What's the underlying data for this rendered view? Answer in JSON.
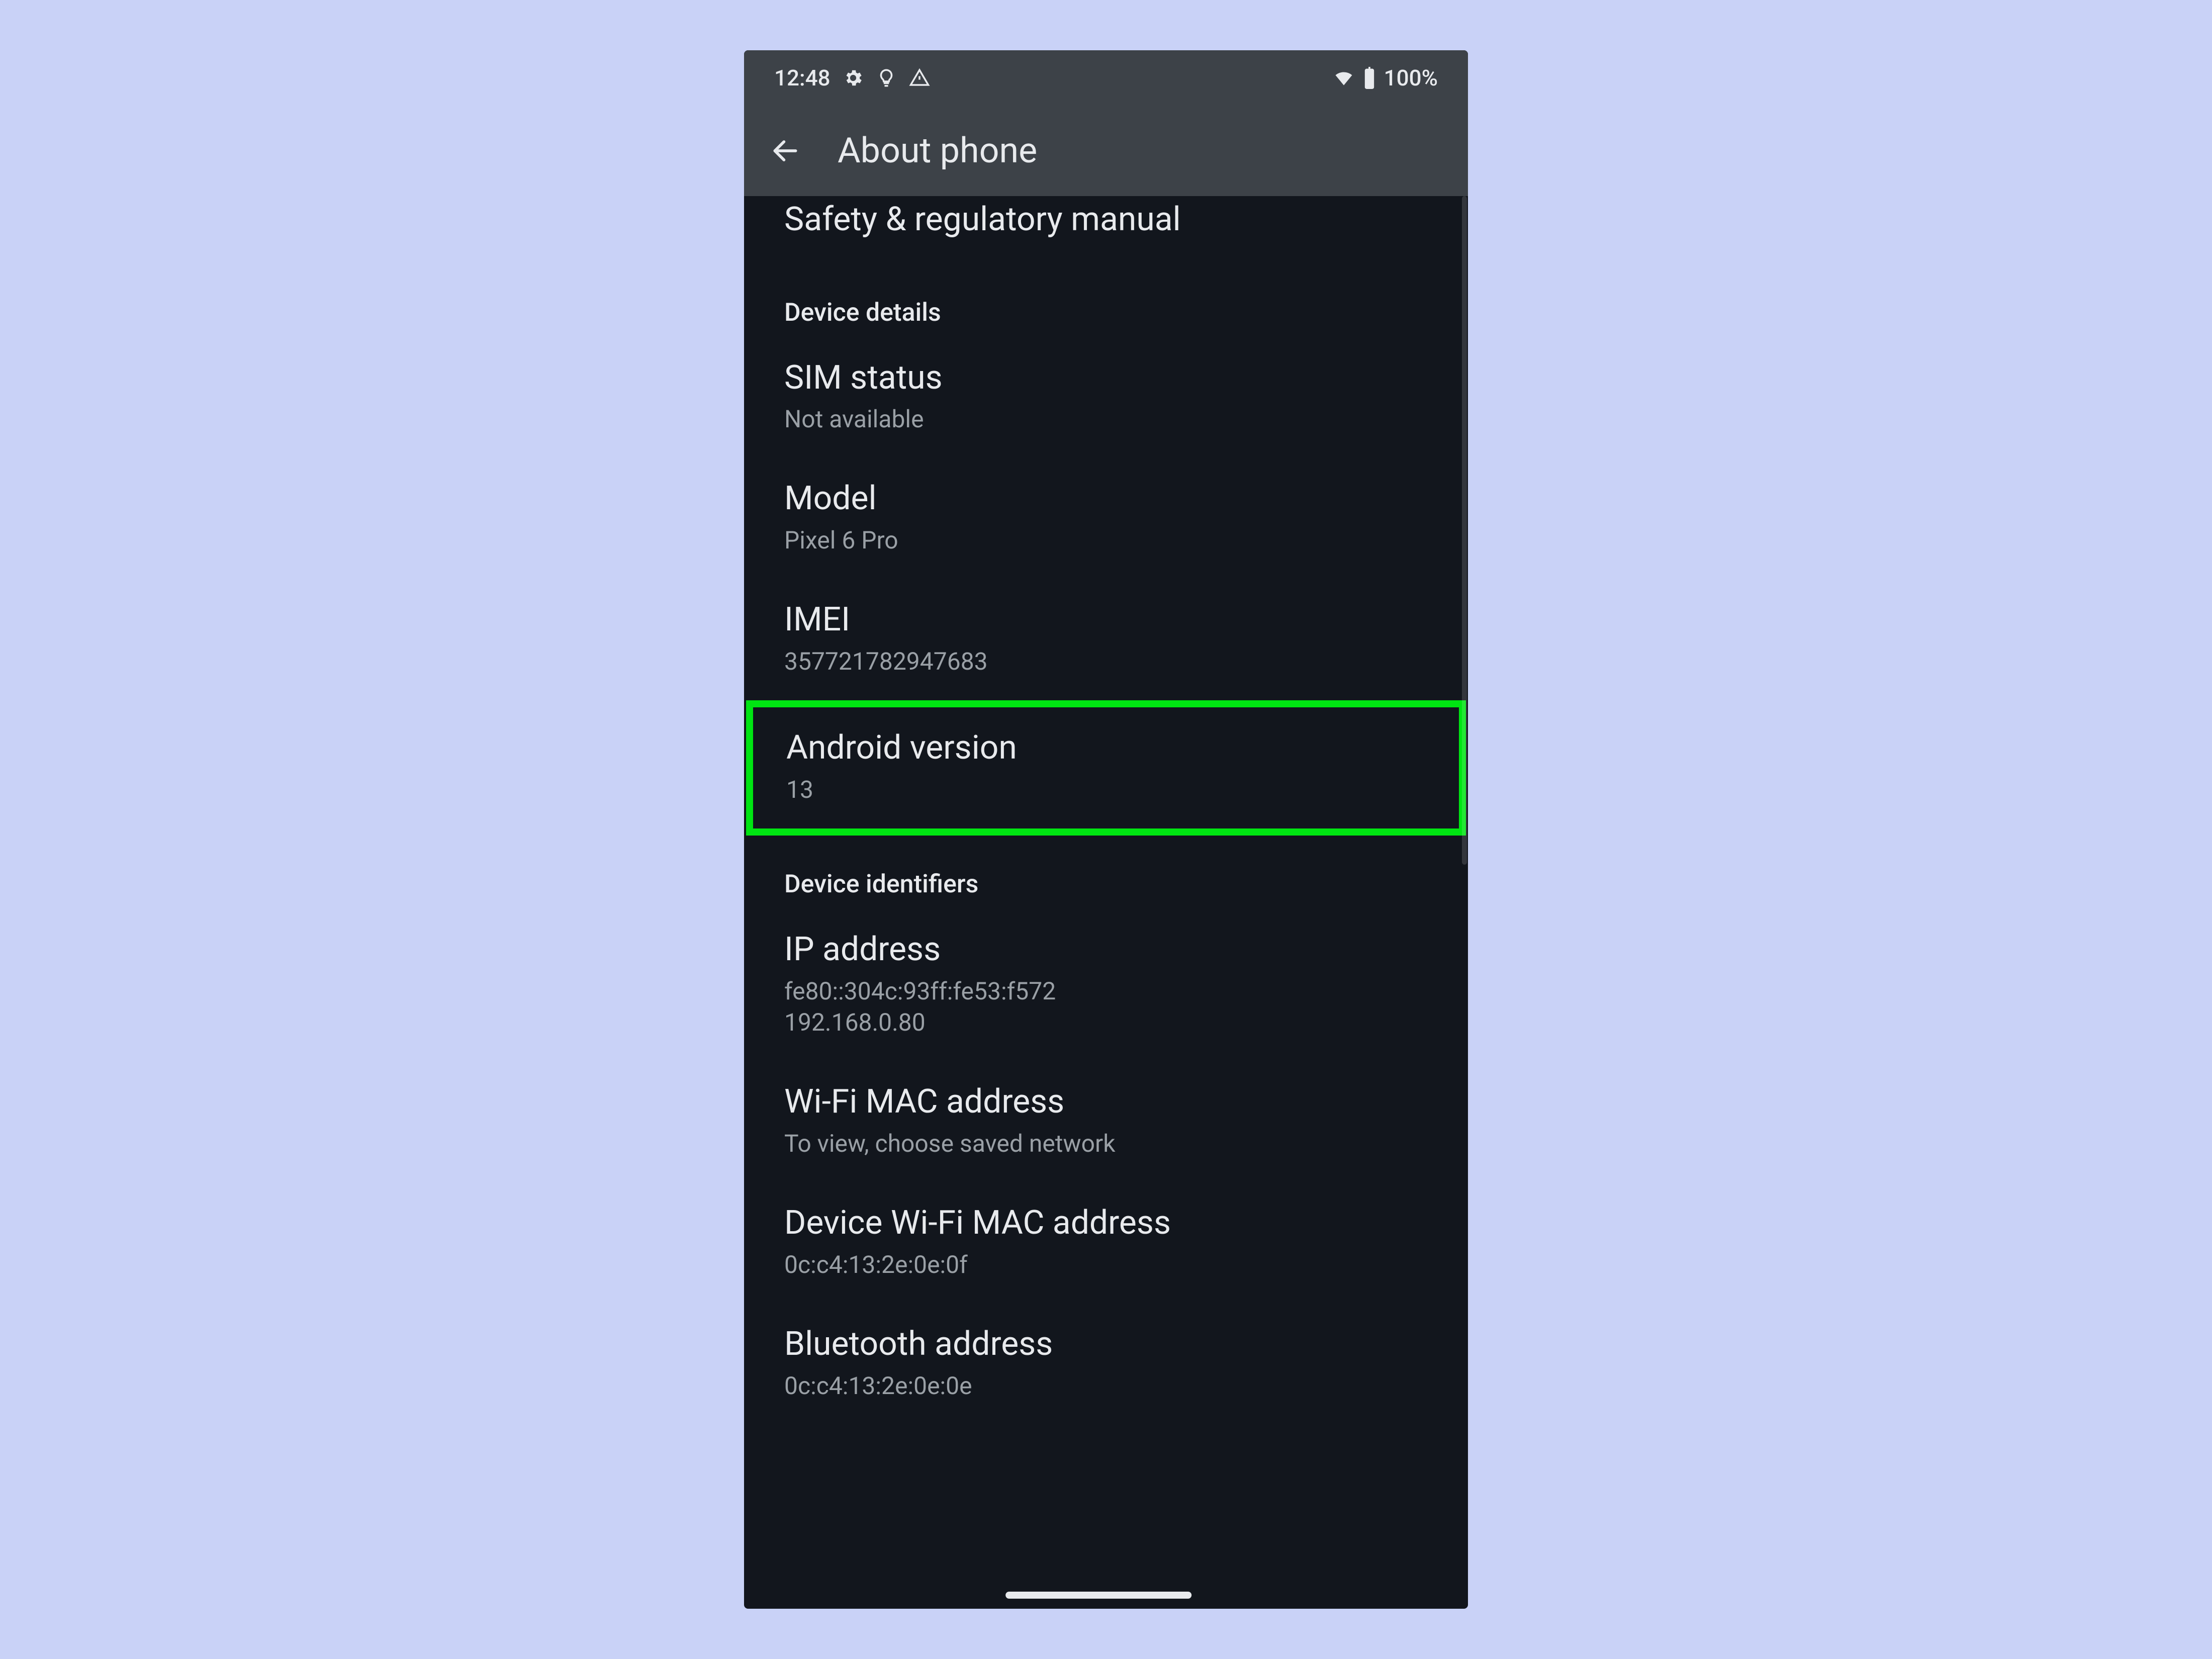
{
  "status_bar": {
    "time": "12:48",
    "battery_text": "100%"
  },
  "header": {
    "title": "About phone"
  },
  "top_item": {
    "title": "Safety & regulatory manual"
  },
  "section_device_details": "Device details",
  "items_a": [
    {
      "title": "SIM status",
      "sub": "Not available"
    },
    {
      "title": "Model",
      "sub": "Pixel 6 Pro"
    },
    {
      "title": "IMEI",
      "sub": "357721782947683"
    }
  ],
  "highlight": {
    "title": "Android version",
    "sub": "13"
  },
  "section_device_identifiers": "Device identifiers",
  "items_b": [
    {
      "title": "IP address",
      "sub1": "fe80::304c:93ff:fe53:f572",
      "sub2": "192.168.0.80"
    },
    {
      "title": "Wi-Fi MAC address",
      "sub": "To view, choose saved network"
    },
    {
      "title": "Device Wi-Fi MAC address",
      "sub": "0c:c4:13:2e:0e:0f"
    },
    {
      "title": "Bluetooth address",
      "sub": "0c:c4:13:2e:0e:0e"
    }
  ]
}
